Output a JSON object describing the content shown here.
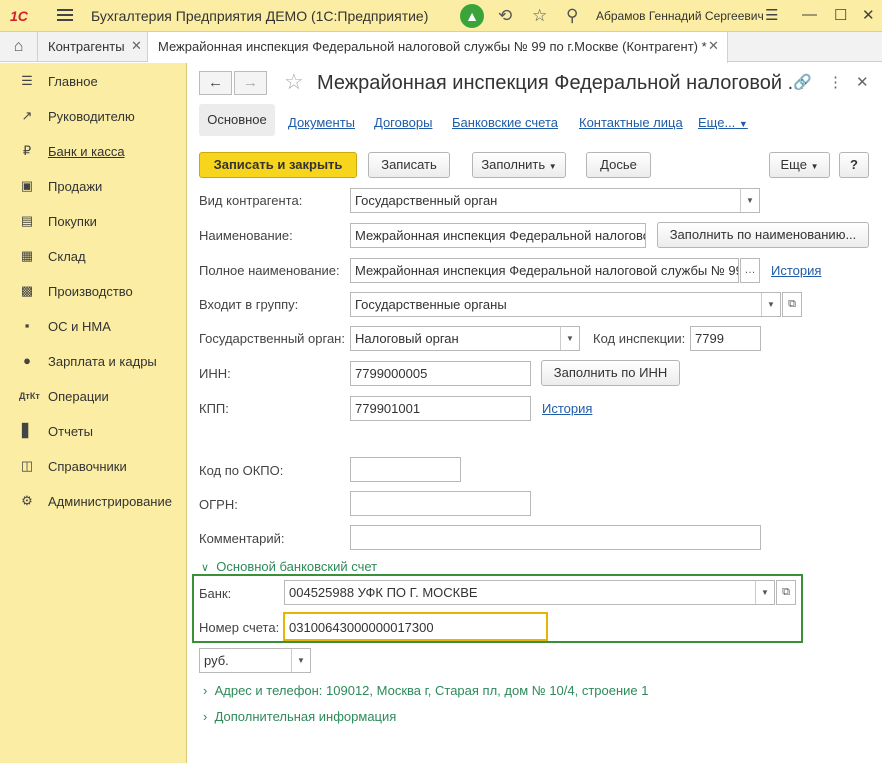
{
  "app": {
    "logo": "1С",
    "title": "Бухгалтерия Предприятия ДЕМО  (1С:Предприятие)",
    "user": "Абрамов Геннадий Сергеевич"
  },
  "tabs": {
    "tab1": "Контрагенты",
    "tab2": "Межрайонная инспекция Федеральной налоговой службы № 99 по г.Москве (Контрагент) *"
  },
  "sidebar": {
    "items": [
      {
        "label": "Главное",
        "icon": "menu-icon"
      },
      {
        "label": "Руководителю",
        "icon": "chart-trend-icon"
      },
      {
        "label": "Банк и касса",
        "icon": "ruble-icon"
      },
      {
        "label": "Продажи",
        "icon": "bag-icon"
      },
      {
        "label": "Покупки",
        "icon": "cart-icon"
      },
      {
        "label": "Склад",
        "icon": "warehouse-icon"
      },
      {
        "label": "Производство",
        "icon": "factory-icon"
      },
      {
        "label": "ОС и НМА",
        "icon": "truck-icon"
      },
      {
        "label": "Зарплата и кадры",
        "icon": "person-icon"
      },
      {
        "label": "Операции",
        "icon": "dt-kt-icon"
      },
      {
        "label": "Отчеты",
        "icon": "bar-chart-icon"
      },
      {
        "label": "Справочники",
        "icon": "book-icon"
      },
      {
        "label": "Администрирование",
        "icon": "gear-icon"
      }
    ]
  },
  "form": {
    "title": "Межрайонная инспекция Федеральной налоговой ...",
    "tabs": [
      "Основное",
      "Документы",
      "Договоры",
      "Банковские счета",
      "Контактные лица",
      "Еще..."
    ],
    "buttons": {
      "save_close": "Записать и закрыть",
      "save": "Записать",
      "fill": "Заполнить",
      "dossier": "Досье",
      "more": "Еще",
      "help": "?"
    },
    "fields": {
      "kind_label": "Вид контрагента:",
      "kind_value": "Государственный орган",
      "name_label": "Наименование:",
      "name_value": "Межрайонная инспекция Федеральной налогово",
      "fill_by_name": "Заполнить по наименованию...",
      "fullname_label": "Полное наименование:",
      "fullname_value": "Межрайонная инспекция Федеральной налоговой службы № 99",
      "history": "История",
      "group_label": "Входит в группу:",
      "group_value": "Государственные органы",
      "gov_label": "Государственный орган:",
      "gov_value": "Налоговый орган",
      "insp_label": "Код инспекции:",
      "insp_value": "7799",
      "inn_label": "ИНН:",
      "inn_value": "7799000005",
      "fill_by_inn": "Заполнить по ИНН",
      "kpp_label": "КПП:",
      "kpp_value": "779901001",
      "kpp_history": "История",
      "okpo_label": "Код по ОКПО:",
      "okpo_value": "",
      "ogrn_label": "ОГРН:",
      "ogrn_value": "",
      "comment_label": "Комментарий:",
      "comment_value": ""
    },
    "bank_section": {
      "title": "Основной банковский счет",
      "bank_label": "Банк:",
      "bank_value": "004525988 УФК ПО Г. МОСКВЕ",
      "account_label": "Номер счета:",
      "account_value": "03100643000000017300",
      "currency": "руб."
    },
    "address_section": "Адрес и телефон: 109012, Москва г, Старая пл, дом № 10/4, строение 1",
    "extra_section": "Дополнительная информация"
  },
  "colors": {
    "sidebar_bg": "#fbeda3",
    "primary_button": "#f7d51d",
    "link": "#1f5ca8",
    "group_header": "#2d8a5a",
    "highlight_box": "#3b8f3b",
    "active_field": "#e8b400"
  }
}
